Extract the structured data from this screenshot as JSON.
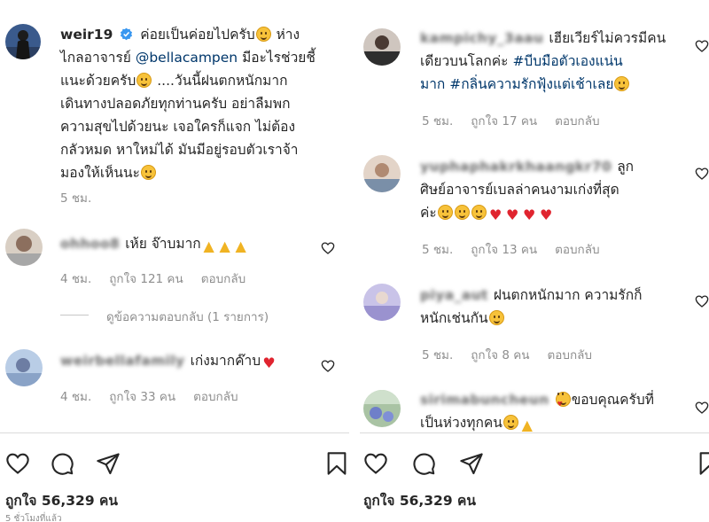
{
  "post": {
    "username": "weir19",
    "caption_lines": [
      "ค่อยเป็นค่อยไปครับ",
      "ห่าง",
      "ไกลอาจารย์",
      "@bellacampen",
      "มีอะไรช่วยชี้",
      "แนะด้วยครับ",
      "....วันนี้ฝนตกหนักมาก",
      "เดินทางปลอดภัยทุกท่านครับ อย่าลืมพก",
      "ความสุขไปด้วยนะ เจอใครก็แจก ไม่ต้อง",
      "กลัวหมด หาใหม่ได้ มันมีอยู่รอบตัวเราจ้า",
      "มองให้เห็นนะ"
    ],
    "time": "5 ชม."
  },
  "left_comments": [
    {
      "user": "ohhoo8",
      "text": "เห้ย จ๊าบมาก",
      "time": "4 ชม.",
      "likes": "ถูกใจ 121 คน",
      "reply": "ตอบกลับ",
      "view_replies": "ดูข้อความตอบกลับ (1 รายการ)"
    },
    {
      "user": "weirbellafamily",
      "text": "เก่งมากค๊าบ",
      "time": "4 ชม.",
      "likes": "ถูกใจ 33 คน",
      "reply": "ตอบกลับ"
    }
  ],
  "right_comments": [
    {
      "user": "kampichy_3aau",
      "lines": [
        "เฮียเวียร์ไม่ควรมีคน",
        "เดียวบนโลกค่ะ"
      ],
      "hashtags": [
        "#บีบมือตัวเองแน่น",
        "มาก #กลิ่นความรักฟุ้งแต่เช้าเลย"
      ],
      "time": "5 ชม.",
      "likes": "ถูกใจ 17 คน",
      "reply": "ตอบกลับ"
    },
    {
      "user": "yuphaphakrkhaangkr70",
      "lines": [
        "ลูก",
        "ศิษย์อาจารย์เบลล่าคนงามเก่งที่สุด",
        "ค่ะ"
      ],
      "time": "5 ชม.",
      "likes": "ถูกใจ 13 คน",
      "reply": "ตอบกลับ"
    },
    {
      "user": "piya_aut",
      "lines": [
        "ฝนตกหนักมาก ความรักก็",
        "หนักเช่นกัน"
      ],
      "time": "5 ชม.",
      "likes": "ถูกใจ 8 คน",
      "reply": "ตอบกลับ"
    },
    {
      "user": "sirimabuncheun",
      "lines": [
        "ขอบคุณครับที่",
        "เป็นห่วงทุกคน"
      ]
    }
  ],
  "footer": {
    "left_likes": "ถูกใจ 56,329 คน",
    "right_likes": "ถูกใจ 56,329 คน",
    "left_timestamp": "5 ชั่วโมงที่แล้ว"
  },
  "icons": [
    "heart-icon",
    "comment-icon",
    "share-icon",
    "bookmark-icon",
    "verified-badge-icon"
  ],
  "colors": {
    "link": "#00376b",
    "meta": "#8e8e8e",
    "text": "#262626",
    "verified": "#3897f0",
    "heart_red": "#e0242f"
  }
}
